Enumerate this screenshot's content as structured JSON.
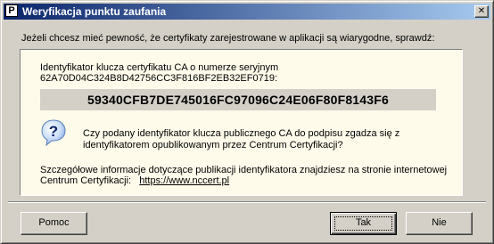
{
  "window": {
    "title": "Weryfikacja punktu zaufania",
    "app_icon_letter": "P",
    "close_glyph": "✕"
  },
  "intro_text": "Jeżeli chcesz mieć pewność, że certyfikaty zarejestrowane w aplikacji są wiarygodne, sprawdź:",
  "panel": {
    "line1": "Identyfikator klucza certyfikatu CA o numerze seryjnym",
    "serial_line": "62A70D04C324B8D42756CC3F816BF2EB32EF0719:",
    "fingerprint": "59340CFB7DE745016FC97096C24E06F80F8143F6",
    "question_line1": "Czy podany identyfikator klucza publicznego CA do podpisu zgadza się z",
    "question_line2": "identyfikatorem opublikowanym przez Centrum Certyfikacji?",
    "info_line1": "Szczegółowe informacje dotyczące publikacji identyfikatora znajdziesz na stronie internetowej",
    "info_line2_prefix": "Centrum Certyfikacji:",
    "info_link": "https://www.nccert.pl"
  },
  "buttons": {
    "help": "Pomoc",
    "yes": "Tak",
    "no": "Nie"
  }
}
